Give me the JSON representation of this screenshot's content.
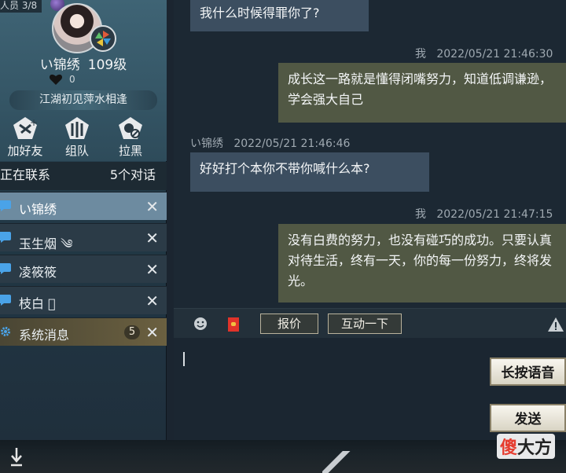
{
  "profile": {
    "corner_label": "人员 3/8",
    "name": "い锦绣",
    "level": "109级",
    "likes": "0",
    "signature": "江湖初见萍水相逢"
  },
  "actions": [
    {
      "label": "加好友",
      "icon": "add-friend-icon"
    },
    {
      "label": "组队",
      "icon": "team-icon"
    },
    {
      "label": "拉黑",
      "icon": "block-icon"
    }
  ],
  "contacts": {
    "header_label": "正在联系",
    "header_count": "5个对话",
    "items": [
      {
        "name": "い锦绣",
        "active": true
      },
      {
        "name": "玉生烟 ༄",
        "active": false
      },
      {
        "name": "凌筱筱",
        "active": false
      },
      {
        "name": "枝白 ゙",
        "active": false
      },
      {
        "name": "系统消息",
        "count": "5",
        "system": true
      }
    ],
    "close_glyph": "✕"
  },
  "chat": {
    "messages": [
      {
        "dir": "in",
        "text": "我什么时候得罪你了?"
      },
      {
        "dir": "out",
        "sender": "我",
        "time": "2022/05/21  21:46:30",
        "text": "成长这一路就是懂得闭嘴努力，知道低调谦逊，学会强大自己"
      },
      {
        "dir": "in",
        "sender": "い锦绣",
        "time": "2022/05/21  21:46:46",
        "text": "好好打个本你不带你喊什么本?"
      },
      {
        "dir": "out",
        "sender": "我",
        "time": "2022/05/21  21:47:15",
        "text": "没有白费的努力，也没有碰巧的成功。只要认真对待生活，终有一天，你的每一份努力，终将发光。"
      }
    ]
  },
  "toolbar": {
    "price_label": "报价",
    "interact_label": "互动一下"
  },
  "input": {
    "voice_label": "长按语音",
    "send_label": "发送"
  },
  "watermark": {
    "part1": "傻",
    "part2": "大方"
  },
  "colors": {
    "panel": "#2b3b47",
    "active_item": "#6d8ba0",
    "incoming_bubble": "#3c4e60",
    "outgoing_bubble": "#515844"
  }
}
